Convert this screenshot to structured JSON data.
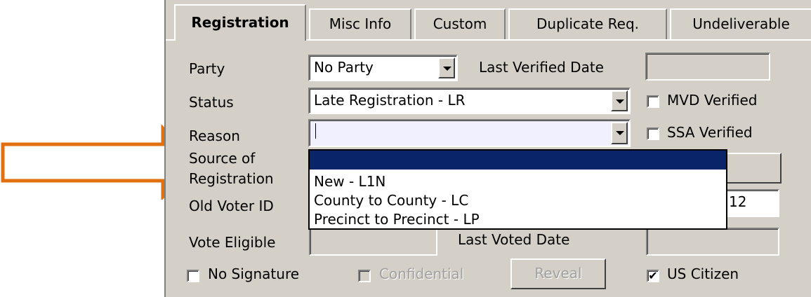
{
  "tabs": [
    "Registration",
    "Misc Info",
    "Custom",
    "Duplicate Req.",
    "Undeliverable"
  ],
  "labels": {
    "party": "Party",
    "status": "Status",
    "reason": "Reason",
    "source_line1": "Source of",
    "source_line2": "Registration",
    "old_voter_id": "Old Voter ID",
    "vote_eligible": "Vote Eligible",
    "last_verified_date": "Last Verified Date",
    "last_voted_date": "Last Voted Date"
  },
  "fields": {
    "party_value": "No Party",
    "status_value": "Late Registration - LR",
    "reason_value": "",
    "partial_field_value": "12"
  },
  "checkboxes": {
    "mvd_verified": {
      "label": "MVD Verified",
      "checked": false
    },
    "ssa_verified": {
      "label": "SSA Verified",
      "checked": false
    },
    "no_signature": {
      "label": "No Signature",
      "checked": false
    },
    "confidential": {
      "label": "Confidential",
      "checked": false,
      "disabled": true
    },
    "us_citizen": {
      "label": "US Citizen",
      "checked": true
    }
  },
  "buttons": {
    "reveal": "Reveal"
  },
  "reason_dropdown_options": [
    "",
    "New - L1N",
    "County to County - LC",
    "Precinct to Precinct - LP"
  ],
  "check_mark": "✔",
  "colors": {
    "panel": "#d4d0c8",
    "selection": "#0a246a",
    "arrow": "#e07010"
  }
}
